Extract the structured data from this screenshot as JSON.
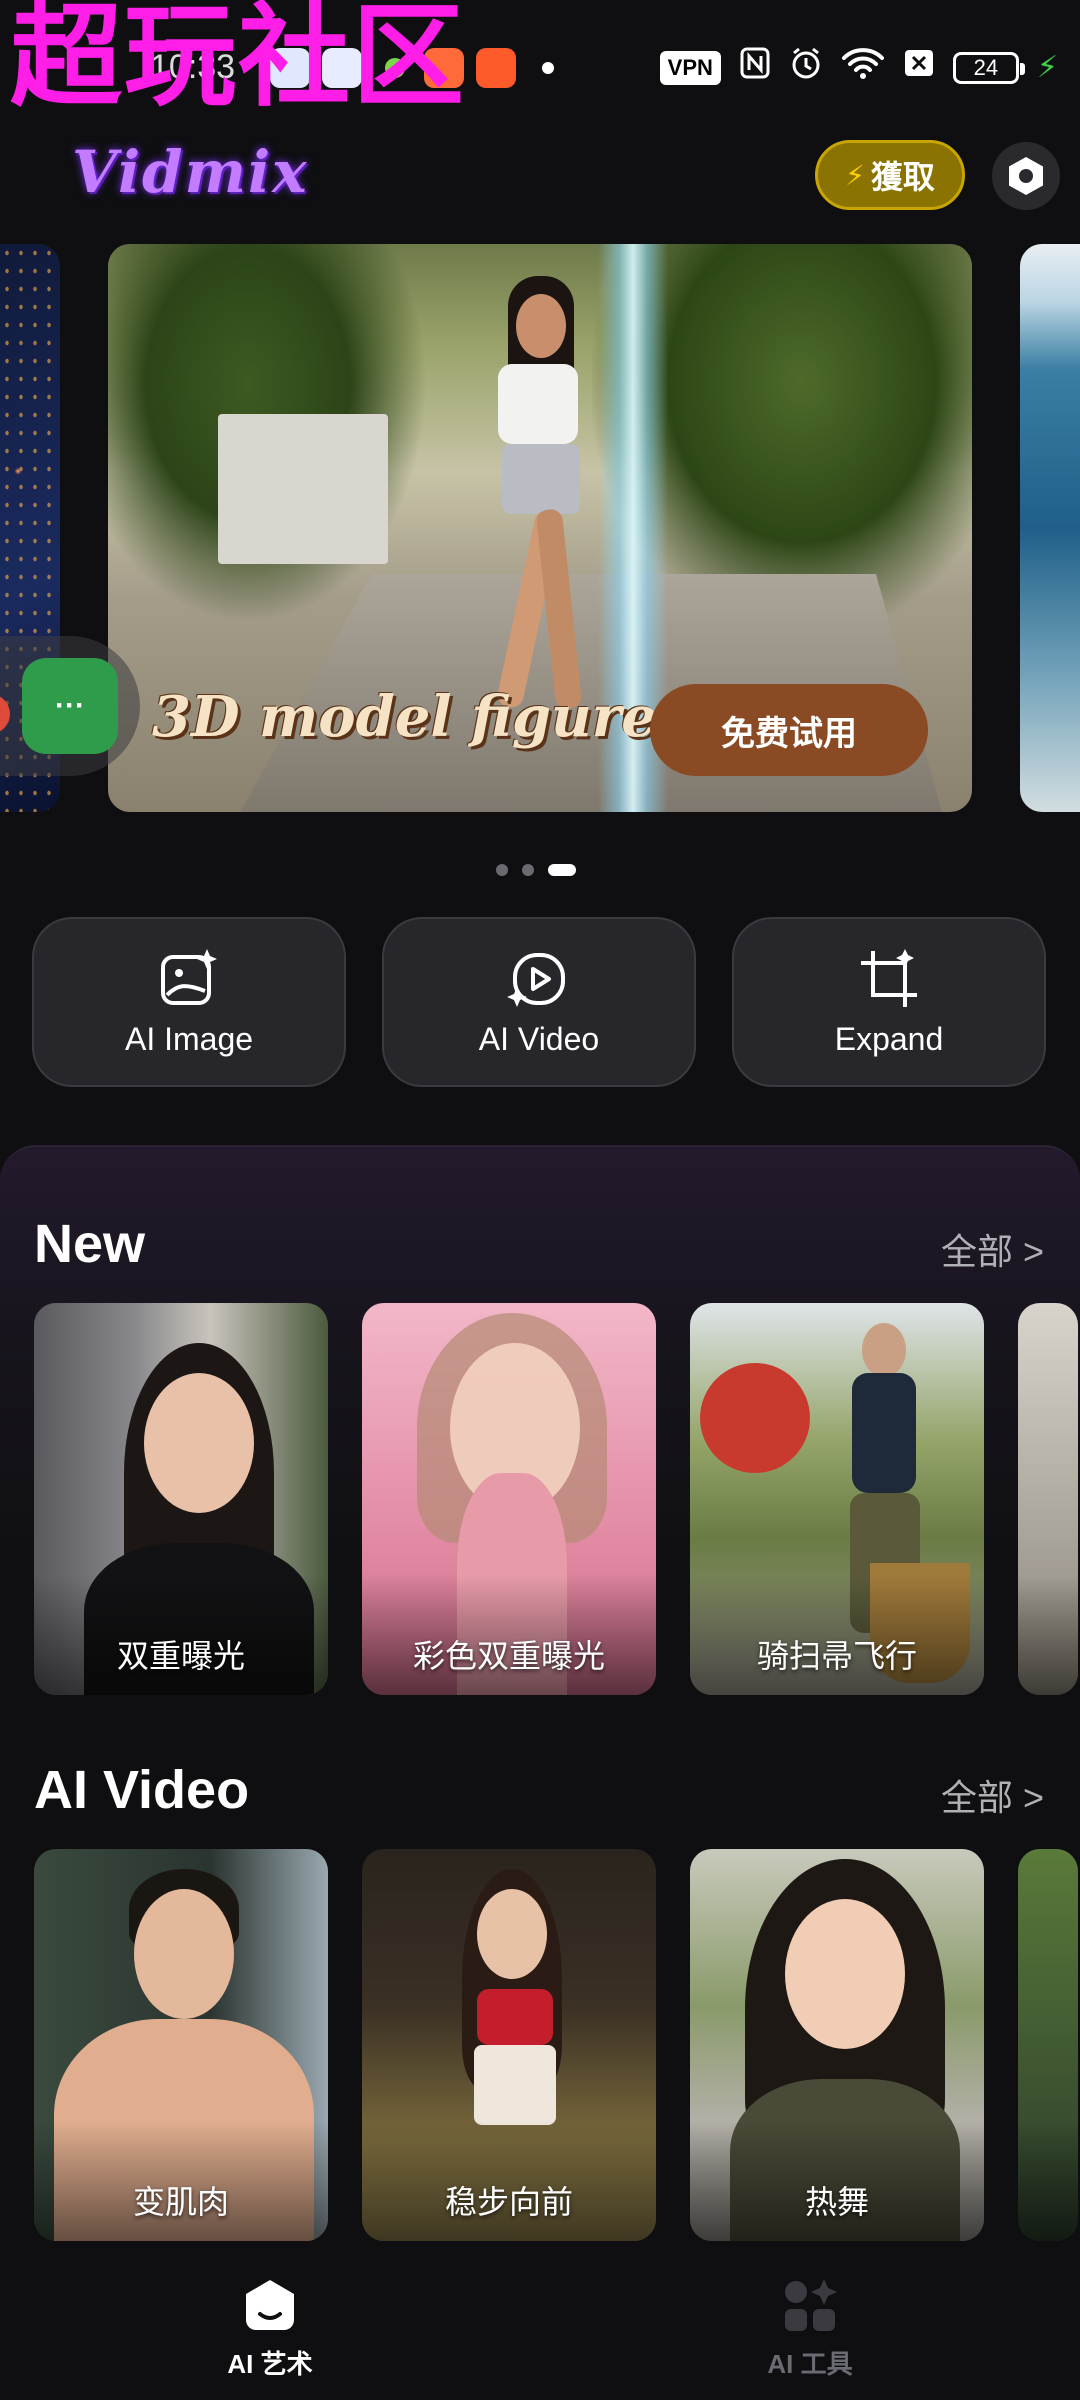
{
  "status_bar": {
    "watermark": "超玩社区",
    "clock": "10:33",
    "vpn": "VPN",
    "battery": "24"
  },
  "header": {
    "logo": "Vidmix",
    "obtain_label": "獲取"
  },
  "banner": {
    "caption": "3D model figure",
    "cta": "免费试用",
    "floating_button": "···"
  },
  "features": [
    {
      "label": "AI Image",
      "icon": "ai-image-icon"
    },
    {
      "label": "AI Video",
      "icon": "ai-video-icon"
    },
    {
      "label": "Expand",
      "icon": "expand-icon"
    }
  ],
  "sections": {
    "new": {
      "title": "New",
      "all": "全部 >",
      "items": [
        "双重曝光",
        "彩色双重曝光",
        "骑扫帚飞行"
      ]
    },
    "ai_video": {
      "title": "AI Video",
      "all": "全部 >",
      "items": [
        "变肌肉",
        "稳步向前",
        "热舞"
      ]
    }
  },
  "bottom_nav": [
    {
      "label": "AI 艺术",
      "active": true
    },
    {
      "label": "AI 工具",
      "active": false
    }
  ],
  "colors": {
    "background": "#0f0f12",
    "watermark": "#ff1ee8",
    "obtain_button": "#8a7300",
    "cta_button": "#8a4a24"
  }
}
